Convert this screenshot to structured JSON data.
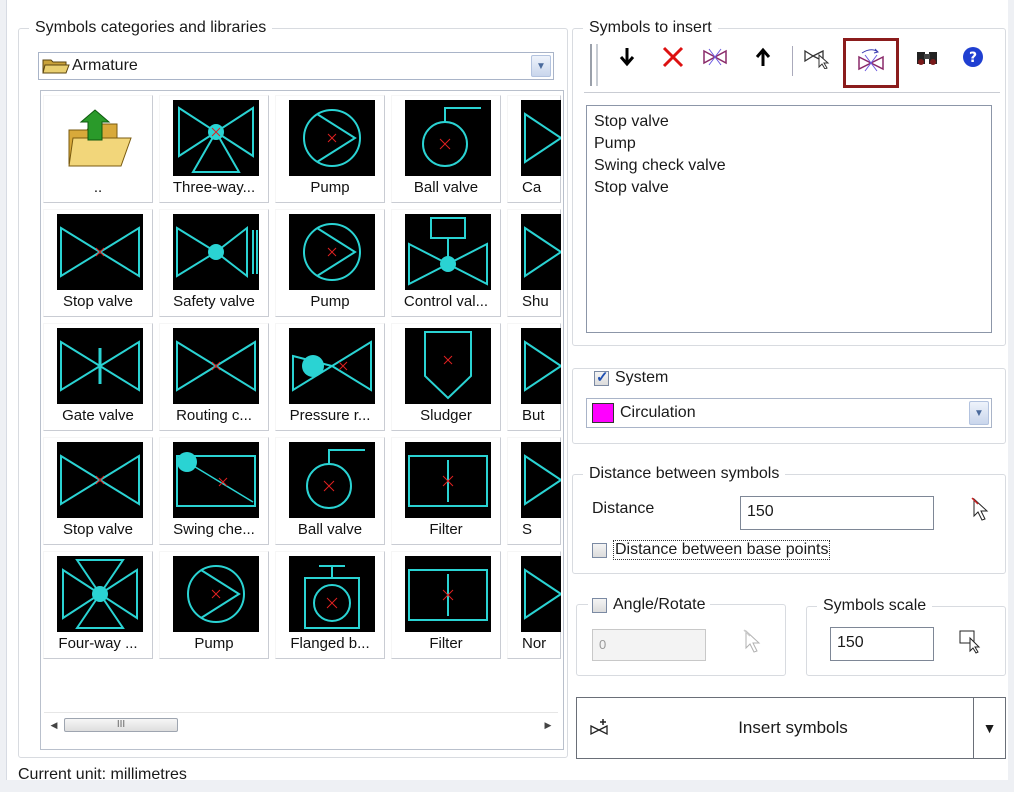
{
  "left_panel": {
    "title": "Symbols categories and libraries",
    "category_select": {
      "value": "Armature"
    },
    "tiles": [
      {
        "label": "..",
        "icon": "folder-up-icon"
      },
      {
        "label": "Three-way...",
        "icon": "three-way-valve-icon"
      },
      {
        "label": "Pump",
        "icon": "pump-icon"
      },
      {
        "label": "Ball valve",
        "icon": "ball-valve-icon"
      },
      {
        "label": "Ca",
        "icon": "partial-valve-icon"
      },
      {
        "label": "Stop valve",
        "icon": "stop-valve-icon"
      },
      {
        "label": "Safety valve",
        "icon": "safety-valve-icon"
      },
      {
        "label": "Pump",
        "icon": "pump-icon"
      },
      {
        "label": "Control val...",
        "icon": "control-valve-icon"
      },
      {
        "label": "Shu",
        "icon": "partial-valve-icon"
      },
      {
        "label": "Gate valve",
        "icon": "gate-valve-icon"
      },
      {
        "label": "Routing c...",
        "icon": "routing-valve-icon"
      },
      {
        "label": "Pressure r...",
        "icon": "pressure-valve-icon"
      },
      {
        "label": "Sludger",
        "icon": "sludger-icon"
      },
      {
        "label": "But",
        "icon": "partial-valve-icon"
      },
      {
        "label": "Stop valve",
        "icon": "stop-valve-icon"
      },
      {
        "label": "Swing che...",
        "icon": "swing-check-valve-icon"
      },
      {
        "label": "Ball valve",
        "icon": "ball-valve-icon"
      },
      {
        "label": "Filter",
        "icon": "filter-icon"
      },
      {
        "label": "S",
        "icon": "partial-valve-icon"
      },
      {
        "label": "Four-way ...",
        "icon": "four-way-valve-icon"
      },
      {
        "label": "Pump",
        "icon": "pump-icon"
      },
      {
        "label": "Flanged b...",
        "icon": "flanged-valve-icon"
      },
      {
        "label": "Filter",
        "icon": "filter-icon"
      },
      {
        "label": "Nor",
        "icon": "partial-valve-icon"
      }
    ],
    "scrollbar_thumb_text": "III"
  },
  "right_panel": {
    "symbols_to_insert_title": "Symbols to insert",
    "toolbar": [
      {
        "name": "move-down-icon"
      },
      {
        "name": "delete-icon"
      },
      {
        "name": "swap-symbol-icon"
      },
      {
        "name": "move-up-icon"
      },
      {
        "name": "pick-symbol-icon"
      },
      {
        "name": "replace-symbol-icon"
      },
      {
        "name": "find-icon"
      },
      {
        "name": "help-icon"
      }
    ],
    "list_items": [
      "Stop valve",
      "Pump",
      "Swing check valve",
      "Stop valve"
    ],
    "system": {
      "label": "System",
      "checked": true,
      "value": "Circulation",
      "color": "#ff00ff"
    },
    "distance_group": {
      "title": "Distance between symbols",
      "distance_label": "Distance",
      "distance_value": "150",
      "base_points_label": "Distance between base points"
    },
    "angle": {
      "label": "Angle/Rotate",
      "value": "0"
    },
    "scale": {
      "title": "Symbols scale",
      "value": "150"
    },
    "insert_button_label": "Insert symbols"
  },
  "status_bar": {
    "text": "Current unit: millimetres"
  }
}
